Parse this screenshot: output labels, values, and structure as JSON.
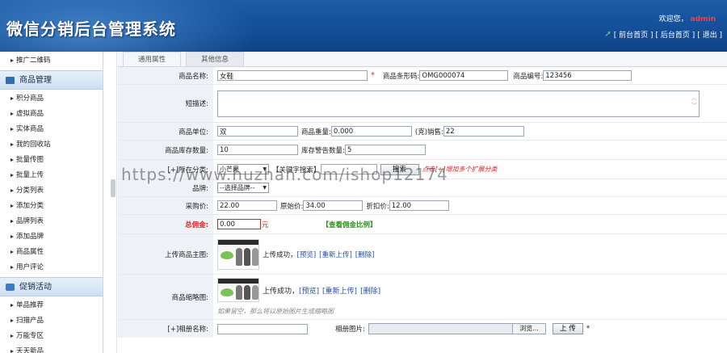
{
  "header": {
    "title": "微信分销后台管理系统",
    "welcome": "欢迎您，",
    "username": "admin",
    "links": [
      "[ 前台首页 ]",
      "[ 后台首页 ]",
      "[ 退出 ]"
    ]
  },
  "sidebar": {
    "top_item": "推广二维码",
    "groups": [
      {
        "title": "商品管理",
        "items": [
          "积分商品",
          "虚拟商品",
          "实体商品",
          "我的回收站",
          "批量传图",
          "批量上传",
          "分类列表",
          "添加分类",
          "品牌列表",
          "添加品牌",
          "商品属性",
          "用户评论"
        ]
      },
      {
        "title": "促销活动",
        "items": [
          "单品推荐",
          "扫描产品",
          "万能专区",
          "天天新品"
        ]
      }
    ]
  },
  "tabs": [
    "通用属性",
    "其他信息"
  ],
  "form": {
    "name_label": "商品名称:",
    "name_value": "女鞋",
    "barcode_label": "商品条形码:",
    "barcode_value": "OMG000074",
    "code_label": "商品编号:",
    "code_value": "123456",
    "brief_label": "短描述:",
    "unit_label": "商品单位:",
    "unit_value": "双",
    "weight_label": "商品重量:",
    "weight_value": "0.000",
    "weight_unit": "(克)",
    "sales_label": "销售:",
    "sales_value": "22",
    "stock_label": "商品库存数量:",
    "stock_value": "10",
    "warn_label": "库存警告数量:",
    "warn_value": "5",
    "category_label": "[+]所在分类:",
    "category_value": "小芒果",
    "keyword_label": "【关键字搜索】",
    "search_button": "搜索",
    "category_hint": "点击[+]增加多个扩展分类",
    "brand_label": "品牌:",
    "brand_value": "--选择品牌--",
    "purchase_label": "采购价:",
    "purchase_value": "22.00",
    "original_label": "原始价:",
    "original_value": "34.00",
    "discount_label": "折扣价:",
    "discount_value": "12.00",
    "commission_label": "总佣金:",
    "commission_value": "0.00",
    "commission_unit": "元",
    "commission_link": "【查看佣金比例】",
    "main_image_label": "上传商品主图:",
    "upload_success": "上传成功，",
    "preview_link": "[预览]",
    "reupload_link": "[重新上传]",
    "delete_link": "[删除]",
    "thumb_label": "商品缩略图:",
    "thumb_note": "如果留空，那么将以原始图片生成缩略图",
    "album_name_label": "[+]相册名称:",
    "album_image_label": "相册图片:",
    "browse_button": "浏览...",
    "upload_button": "上 传",
    "upload_star": "*"
  },
  "watermark": "https://www.huzhan.com/ishop12174",
  "colors": {
    "header_blue": "#1a57a2",
    "accent_red": "#e02020",
    "link_blue": "#1f4fb0",
    "link_green": "#2d8c1e"
  }
}
